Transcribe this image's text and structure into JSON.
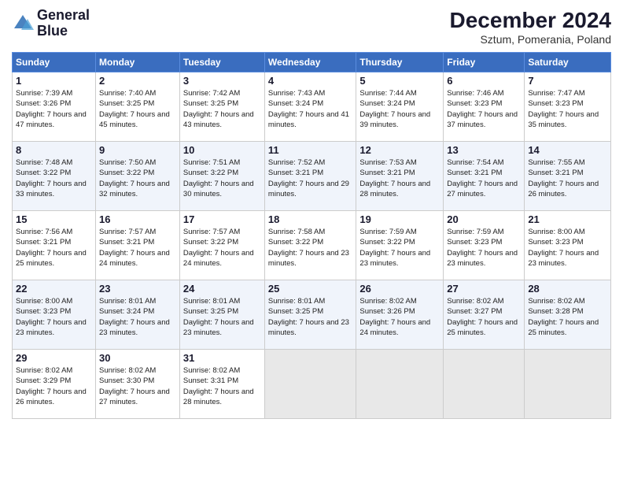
{
  "header": {
    "logo_line1": "General",
    "logo_line2": "Blue",
    "month_title": "December 2024",
    "location": "Sztum, Pomerania, Poland"
  },
  "days_of_week": [
    "Sunday",
    "Monday",
    "Tuesday",
    "Wednesday",
    "Thursday",
    "Friday",
    "Saturday"
  ],
  "weeks": [
    [
      {
        "day": "1",
        "sunrise": "7:39 AM",
        "sunset": "3:26 PM",
        "daylight": "7 hours and 47 minutes."
      },
      {
        "day": "2",
        "sunrise": "7:40 AM",
        "sunset": "3:25 PM",
        "daylight": "7 hours and 45 minutes."
      },
      {
        "day": "3",
        "sunrise": "7:42 AM",
        "sunset": "3:25 PM",
        "daylight": "7 hours and 43 minutes."
      },
      {
        "day": "4",
        "sunrise": "7:43 AM",
        "sunset": "3:24 PM",
        "daylight": "7 hours and 41 minutes."
      },
      {
        "day": "5",
        "sunrise": "7:44 AM",
        "sunset": "3:24 PM",
        "daylight": "7 hours and 39 minutes."
      },
      {
        "day": "6",
        "sunrise": "7:46 AM",
        "sunset": "3:23 PM",
        "daylight": "7 hours and 37 minutes."
      },
      {
        "day": "7",
        "sunrise": "7:47 AM",
        "sunset": "3:23 PM",
        "daylight": "7 hours and 35 minutes."
      }
    ],
    [
      {
        "day": "8",
        "sunrise": "7:48 AM",
        "sunset": "3:22 PM",
        "daylight": "7 hours and 33 minutes."
      },
      {
        "day": "9",
        "sunrise": "7:50 AM",
        "sunset": "3:22 PM",
        "daylight": "7 hours and 32 minutes."
      },
      {
        "day": "10",
        "sunrise": "7:51 AM",
        "sunset": "3:22 PM",
        "daylight": "7 hours and 30 minutes."
      },
      {
        "day": "11",
        "sunrise": "7:52 AM",
        "sunset": "3:21 PM",
        "daylight": "7 hours and 29 minutes."
      },
      {
        "day": "12",
        "sunrise": "7:53 AM",
        "sunset": "3:21 PM",
        "daylight": "7 hours and 28 minutes."
      },
      {
        "day": "13",
        "sunrise": "7:54 AM",
        "sunset": "3:21 PM",
        "daylight": "7 hours and 27 minutes."
      },
      {
        "day": "14",
        "sunrise": "7:55 AM",
        "sunset": "3:21 PM",
        "daylight": "7 hours and 26 minutes."
      }
    ],
    [
      {
        "day": "15",
        "sunrise": "7:56 AM",
        "sunset": "3:21 PM",
        "daylight": "7 hours and 25 minutes."
      },
      {
        "day": "16",
        "sunrise": "7:57 AM",
        "sunset": "3:21 PM",
        "daylight": "7 hours and 24 minutes."
      },
      {
        "day": "17",
        "sunrise": "7:57 AM",
        "sunset": "3:22 PM",
        "daylight": "7 hours and 24 minutes."
      },
      {
        "day": "18",
        "sunrise": "7:58 AM",
        "sunset": "3:22 PM",
        "daylight": "7 hours and 23 minutes."
      },
      {
        "day": "19",
        "sunrise": "7:59 AM",
        "sunset": "3:22 PM",
        "daylight": "7 hours and 23 minutes."
      },
      {
        "day": "20",
        "sunrise": "7:59 AM",
        "sunset": "3:23 PM",
        "daylight": "7 hours and 23 minutes."
      },
      {
        "day": "21",
        "sunrise": "8:00 AM",
        "sunset": "3:23 PM",
        "daylight": "7 hours and 23 minutes."
      }
    ],
    [
      {
        "day": "22",
        "sunrise": "8:00 AM",
        "sunset": "3:23 PM",
        "daylight": "7 hours and 23 minutes."
      },
      {
        "day": "23",
        "sunrise": "8:01 AM",
        "sunset": "3:24 PM",
        "daylight": "7 hours and 23 minutes."
      },
      {
        "day": "24",
        "sunrise": "8:01 AM",
        "sunset": "3:25 PM",
        "daylight": "7 hours and 23 minutes."
      },
      {
        "day": "25",
        "sunrise": "8:01 AM",
        "sunset": "3:25 PM",
        "daylight": "7 hours and 23 minutes."
      },
      {
        "day": "26",
        "sunrise": "8:02 AM",
        "sunset": "3:26 PM",
        "daylight": "7 hours and 24 minutes."
      },
      {
        "day": "27",
        "sunrise": "8:02 AM",
        "sunset": "3:27 PM",
        "daylight": "7 hours and 25 minutes."
      },
      {
        "day": "28",
        "sunrise": "8:02 AM",
        "sunset": "3:28 PM",
        "daylight": "7 hours and 25 minutes."
      }
    ],
    [
      {
        "day": "29",
        "sunrise": "8:02 AM",
        "sunset": "3:29 PM",
        "daylight": "7 hours and 26 minutes."
      },
      {
        "day": "30",
        "sunrise": "8:02 AM",
        "sunset": "3:30 PM",
        "daylight": "7 hours and 27 minutes."
      },
      {
        "day": "31",
        "sunrise": "8:02 AM",
        "sunset": "3:31 PM",
        "daylight": "7 hours and 28 minutes."
      },
      null,
      null,
      null,
      null
    ]
  ]
}
